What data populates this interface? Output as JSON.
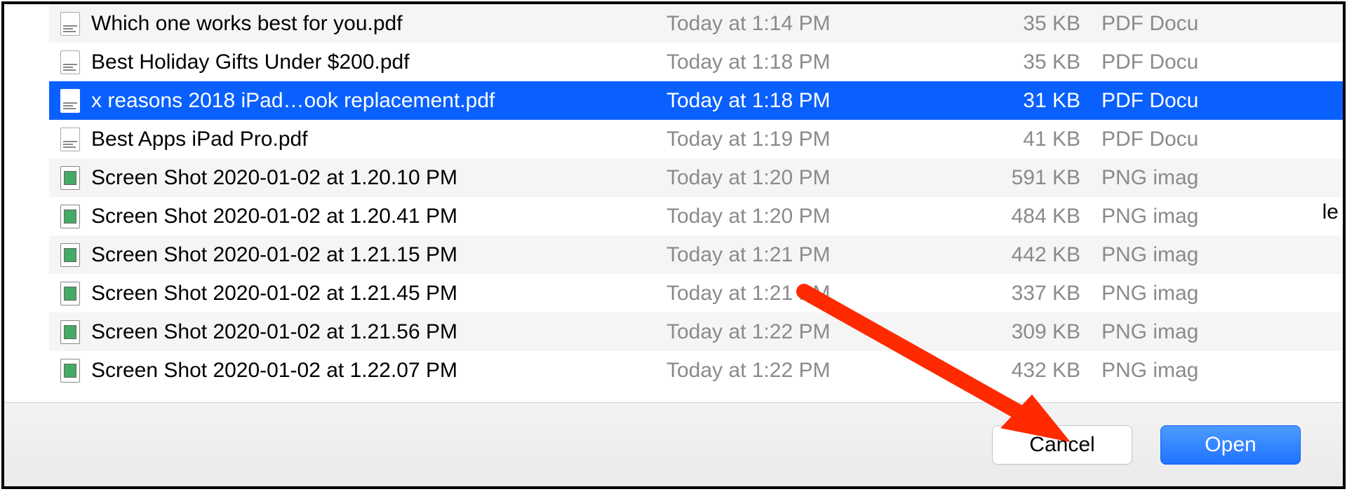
{
  "files": [
    {
      "icon": "pdf",
      "name": "Which one works best for you.pdf",
      "date": "Today at 1:14 PM",
      "size": "35 KB",
      "kind": "PDF Docu",
      "selected": false,
      "alt": true
    },
    {
      "icon": "pdf",
      "name": "Best Holiday Gifts Under $200.pdf",
      "date": "Today at 1:18 PM",
      "size": "35 KB",
      "kind": "PDF Docu",
      "selected": false,
      "alt": false
    },
    {
      "icon": "pdf",
      "name": "x reasons 2018 iPad…ook replacement.pdf",
      "date": "Today at 1:18 PM",
      "size": "31 KB",
      "kind": "PDF Docu",
      "selected": true,
      "alt": true
    },
    {
      "icon": "pdf",
      "name": "Best Apps iPad Pro.pdf",
      "date": "Today at 1:19 PM",
      "size": "41 KB",
      "kind": "PDF Docu",
      "selected": false,
      "alt": false
    },
    {
      "icon": "png",
      "name": "Screen Shot 2020-01-02 at 1.20.10 PM",
      "date": "Today at 1:20 PM",
      "size": "591 KB",
      "kind": "PNG imag",
      "selected": false,
      "alt": true
    },
    {
      "icon": "png",
      "name": "Screen Shot 2020-01-02 at 1.20.41 PM",
      "date": "Today at 1:20 PM",
      "size": "484 KB",
      "kind": "PNG imag",
      "selected": false,
      "alt": false
    },
    {
      "icon": "png",
      "name": "Screen Shot 2020-01-02 at 1.21.15 PM",
      "date": "Today at 1:21 PM",
      "size": "442 KB",
      "kind": "PNG imag",
      "selected": false,
      "alt": true
    },
    {
      "icon": "png",
      "name": "Screen Shot 2020-01-02 at 1.21.45 PM",
      "date": "Today at 1:21 PM",
      "size": "337 KB",
      "kind": "PNG imag",
      "selected": false,
      "alt": false
    },
    {
      "icon": "png",
      "name": "Screen Shot 2020-01-02 at 1.21.56 PM",
      "date": "Today at 1:22 PM",
      "size": "309 KB",
      "kind": "PNG imag",
      "selected": false,
      "alt": true
    },
    {
      "icon": "png",
      "name": "Screen Shot 2020-01-02 at 1.22.07 PM",
      "date": "Today at 1:22 PM",
      "size": "432 KB",
      "kind": "PNG imag",
      "selected": false,
      "alt": false
    }
  ],
  "buttons": {
    "cancel": "Cancel",
    "open": "Open"
  },
  "stray_text": "le"
}
